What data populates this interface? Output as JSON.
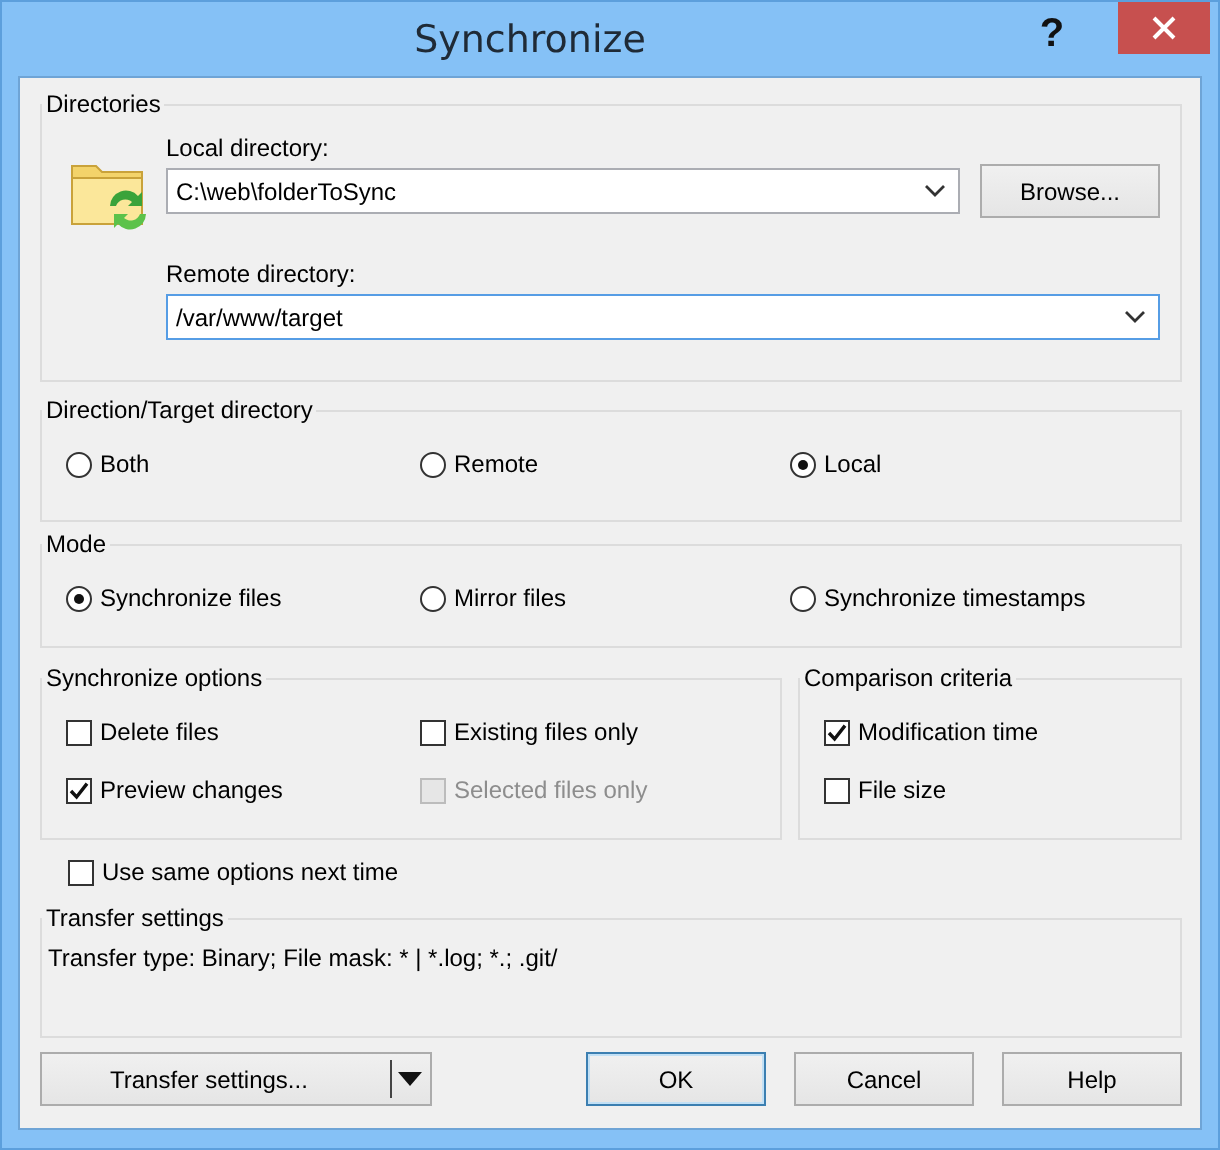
{
  "window": {
    "title": "Synchronize",
    "help_button": "?"
  },
  "directories": {
    "title": "Directories",
    "local": {
      "label": "Local directory:",
      "value": "C:\\web\\folderToSync"
    },
    "browse_button": "Browse...",
    "remote": {
      "label": "Remote directory:",
      "value": "/var/www/target"
    }
  },
  "direction": {
    "title": "Direction/Target directory",
    "options": [
      {
        "label": "Both",
        "selected": false
      },
      {
        "label": "Remote",
        "selected": false
      },
      {
        "label": "Local",
        "selected": true
      }
    ]
  },
  "mode": {
    "title": "Mode",
    "options": [
      {
        "label": "Synchronize files",
        "selected": true
      },
      {
        "label": "Mirror files",
        "selected": false
      },
      {
        "label": "Synchronize timestamps",
        "selected": false
      }
    ]
  },
  "sync_options": {
    "title": "Synchronize options",
    "items": [
      {
        "label": "Delete files",
        "checked": false,
        "disabled": false
      },
      {
        "label": "Existing files only",
        "checked": false,
        "disabled": false
      },
      {
        "label": "Preview changes",
        "checked": true,
        "disabled": false
      },
      {
        "label": "Selected files only",
        "checked": false,
        "disabled": true
      }
    ]
  },
  "comparison": {
    "title": "Comparison criteria",
    "items": [
      {
        "label": "Modification time",
        "checked": true,
        "disabled": false
      },
      {
        "label": "File size",
        "checked": false,
        "disabled": false
      }
    ]
  },
  "same_options": {
    "label": "Use same options next time",
    "checked": false
  },
  "transfer": {
    "title": "Transfer settings",
    "summary": "Transfer type: Binary; File mask: * | *.log; *.; .git/"
  },
  "buttons": [
    {
      "label": "Transfer settings...",
      "kind": "split"
    },
    {
      "label": "OK",
      "kind": "default"
    },
    {
      "label": "Cancel",
      "kind": "normal"
    },
    {
      "label": "Help",
      "kind": "normal"
    }
  ]
}
